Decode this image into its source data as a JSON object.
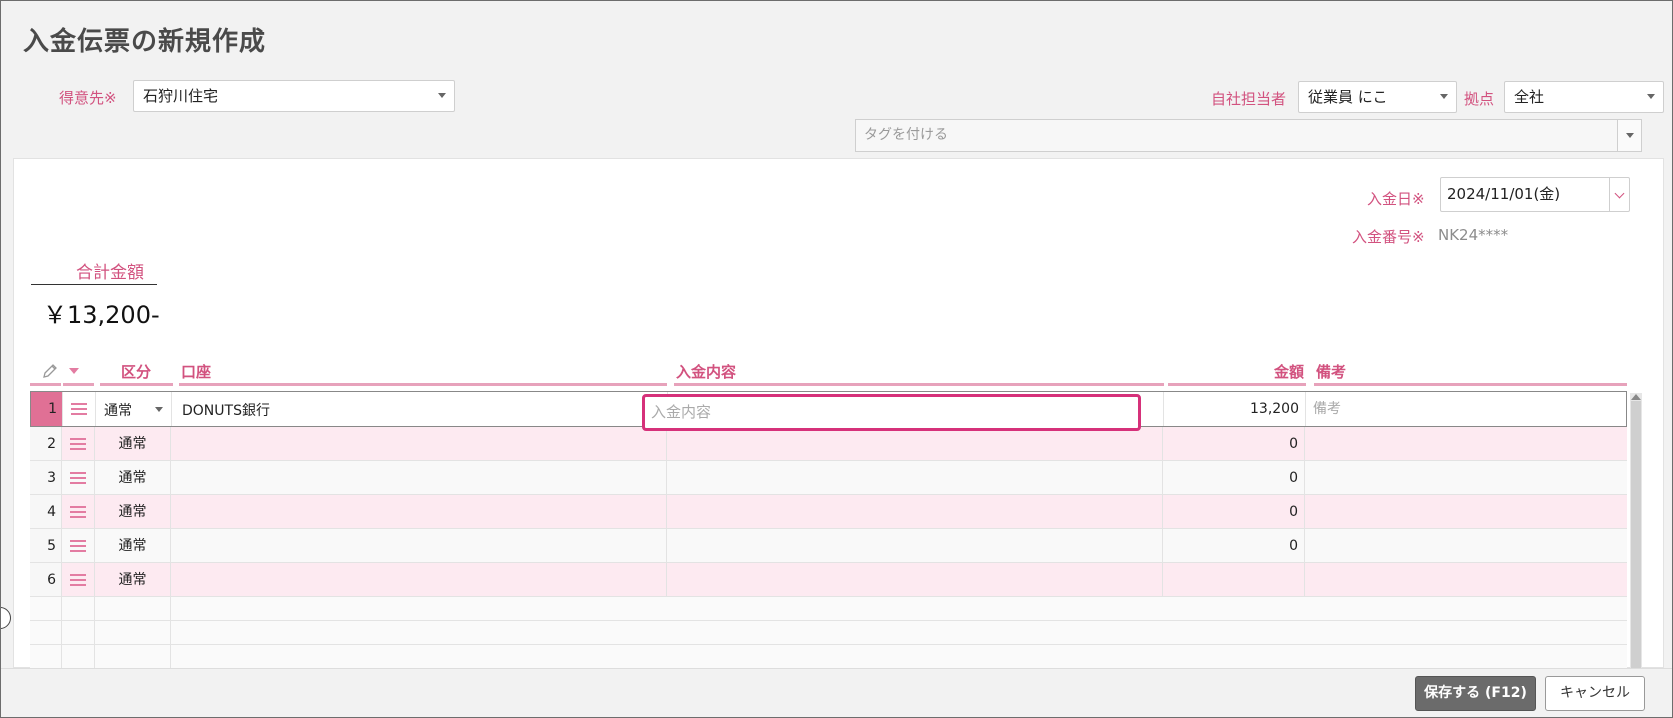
{
  "page": {
    "title": "入金伝票の新規作成"
  },
  "header": {
    "customer_label": "得意先",
    "customer_required": "※",
    "customer_value": "石狩川住宅",
    "staff_label": "自社担当者",
    "staff_value": "従業員 にこ",
    "branch_label": "拠点",
    "branch_value": "全社",
    "tag_placeholder": "タグを付ける"
  },
  "form": {
    "date_label": "入金日",
    "date_required": "※",
    "date_value": "2024/11/01(金)",
    "number_label": "入金番号",
    "number_required": "※",
    "number_value": "NK24****"
  },
  "total": {
    "label": "合計金額",
    "value": "￥13,200-"
  },
  "table": {
    "headers": {
      "type": "区分",
      "account": "口座",
      "description": "入金内容",
      "amount": "金額",
      "note": "備考"
    },
    "desc_placeholder": "入金内容",
    "note_placeholder": "備考",
    "rows": [
      {
        "no": "1",
        "type": "通常",
        "account": "DONUTS銀行",
        "amount": "13,200"
      },
      {
        "no": "2",
        "type": "通常",
        "account": "",
        "amount": "0"
      },
      {
        "no": "3",
        "type": "通常",
        "account": "",
        "amount": "0"
      },
      {
        "no": "4",
        "type": "通常",
        "account": "",
        "amount": "0"
      },
      {
        "no": "5",
        "type": "通常",
        "account": "",
        "amount": "0"
      },
      {
        "no": "6",
        "type": "通常",
        "account": "",
        "amount": ""
      }
    ]
  },
  "footer": {
    "save_label": "保存する (F12)",
    "cancel_label": "キャンセル"
  },
  "colors": {
    "accent": "#d2527f",
    "row_alt": "#fdeaf1",
    "focus": "#d6317a",
    "selected_no": "#e07095"
  },
  "icons": {
    "edit": "pencil-icon",
    "row_menu": "hamburger-icon"
  }
}
